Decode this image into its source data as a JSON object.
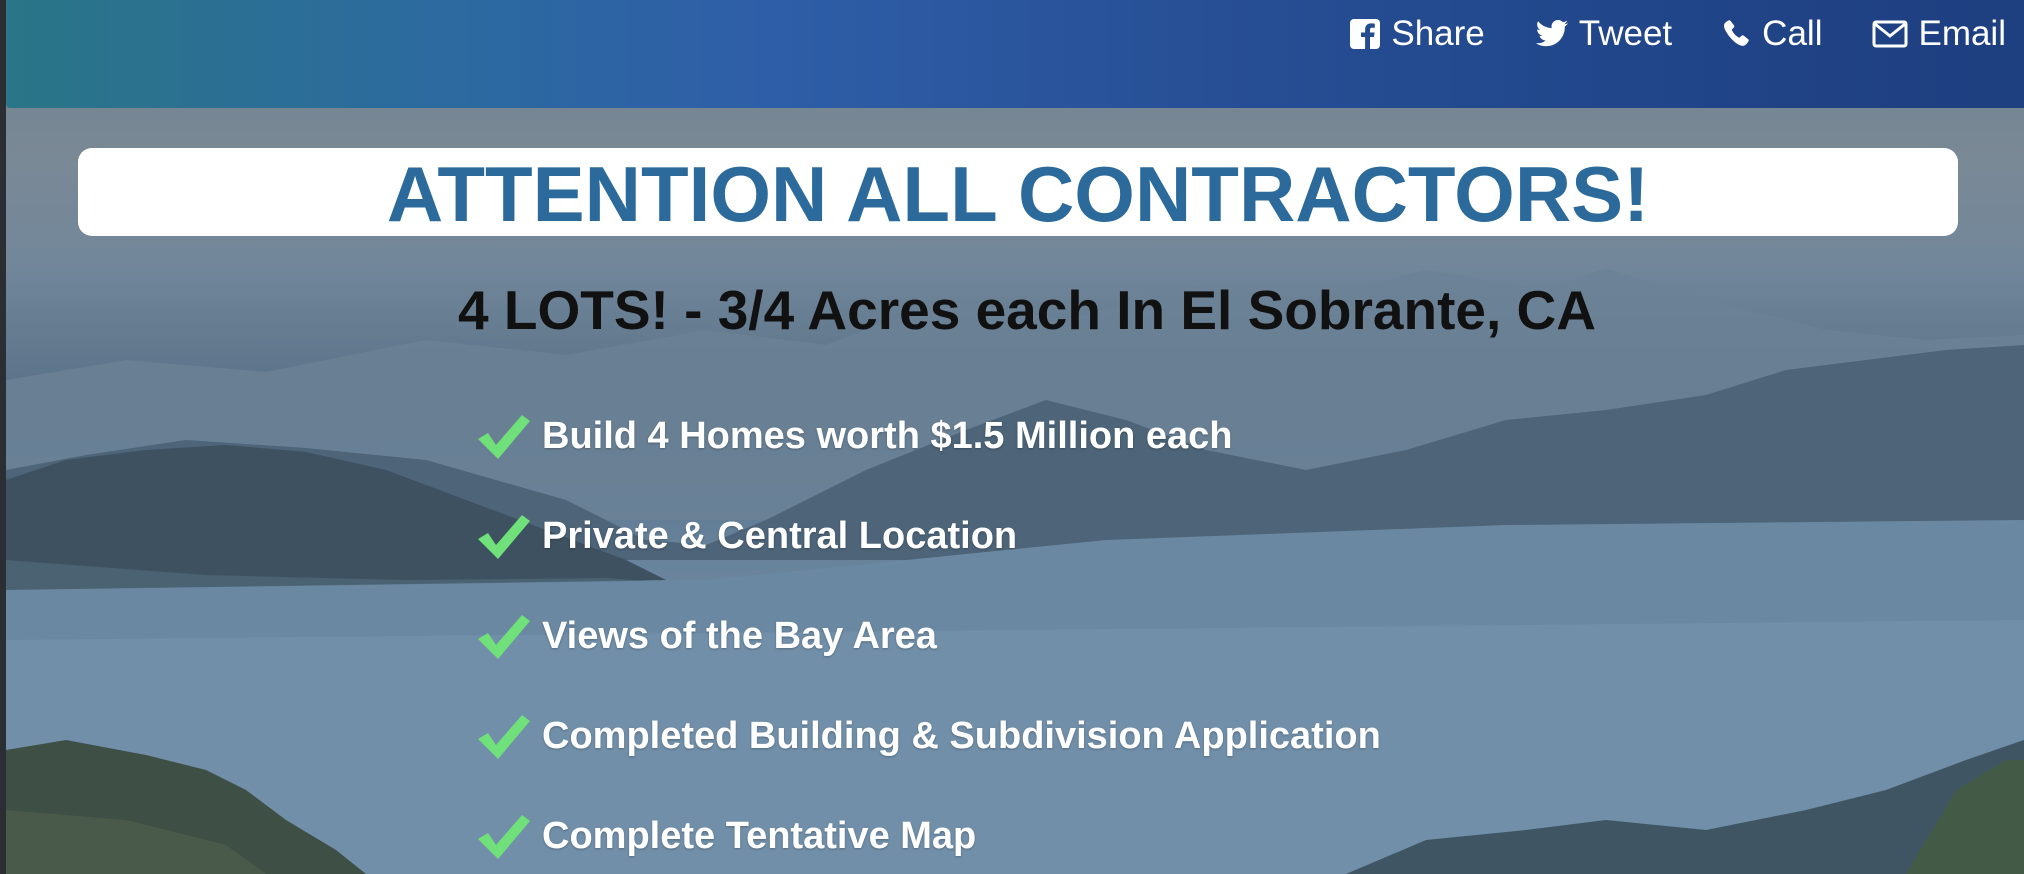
{
  "social": {
    "share": "Share",
    "tweet": "Tweet",
    "call": "Call",
    "email": "Email"
  },
  "headline": "ATTENTION ALL CONTRACTORS!",
  "subhead": "4 LOTS! - 3/4 Acres each In El Sobrante, CA",
  "features": [
    "Build 4 Homes worth $1.5 Million each",
    "Private & Central Location",
    "Views of the Bay Area",
    "Completed Building & Subdivision Application",
    "Complete Tentative Map"
  ],
  "colors": {
    "headline": "#2b6a9a",
    "check": "#6fe07a",
    "topbar_start": "#2a7587",
    "topbar_end": "#1e3f80"
  },
  "icons": [
    "facebook-icon",
    "twitter-icon",
    "phone-icon",
    "envelope-icon",
    "checkmark-icon"
  ]
}
